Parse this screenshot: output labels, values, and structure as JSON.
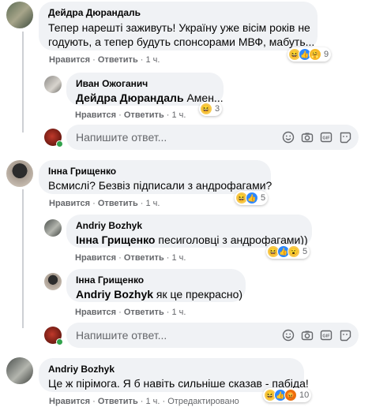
{
  "comments": [
    {
      "author": "Дейдра Дюрандаль",
      "line1": "Тепер нарешті заживуть! Україну уже вісім років не",
      "line2": "годують, а тепер будуть спонсорами МВФ, мабуть...",
      "like": "Нравится",
      "reply": "Ответить",
      "time": "1 ч.",
      "reactions_count": "9"
    },
    {
      "author": "Иван Ожоганич",
      "mention": "Дейдра Дюрандаль",
      "text": " Амен...",
      "like": "Нравится",
      "reply": "Ответить",
      "time": "1 ч.",
      "reactions_count": "3"
    },
    {
      "author": "Інна Грищенко",
      "text": "Всмислі? Безвіз підписали з андрофагами?",
      "like": "Нравится",
      "reply": "Ответить",
      "time": "1 ч.",
      "reactions_count": "5"
    },
    {
      "author": "Andriy Bozhyk",
      "mention": "Інна Грищенко",
      "text": " песиголовці з андрофагами))",
      "like": "Нравится",
      "reply": "Ответить",
      "time": "1 ч.",
      "reactions_count": "5"
    },
    {
      "author": "Інна Грищенко",
      "mention": "Andriy Bozhyk",
      "text": " як це прекрасно)",
      "like": "Нравится",
      "reply": "Ответить",
      "time": "1 ч."
    },
    {
      "author": "Andriy Bozhyk",
      "text": "Це ж пірімога. Я б навіть сильніше сказав - пабіда!",
      "like": "Нравится",
      "reply": "Ответить",
      "time": "1 ч.",
      "edited": "Отредактировано",
      "reactions_count": "10"
    }
  ],
  "reply_input": {
    "placeholder": "Напишите ответ..."
  },
  "icons": [
    "emoji-icon",
    "camera-icon",
    "gif-icon",
    "sticker-icon"
  ],
  "colors": {
    "bubble": "#f0f2f5",
    "meta": "#65676b",
    "like_blue": "#2d88ff",
    "haha_yellow": "#f7c94b"
  }
}
